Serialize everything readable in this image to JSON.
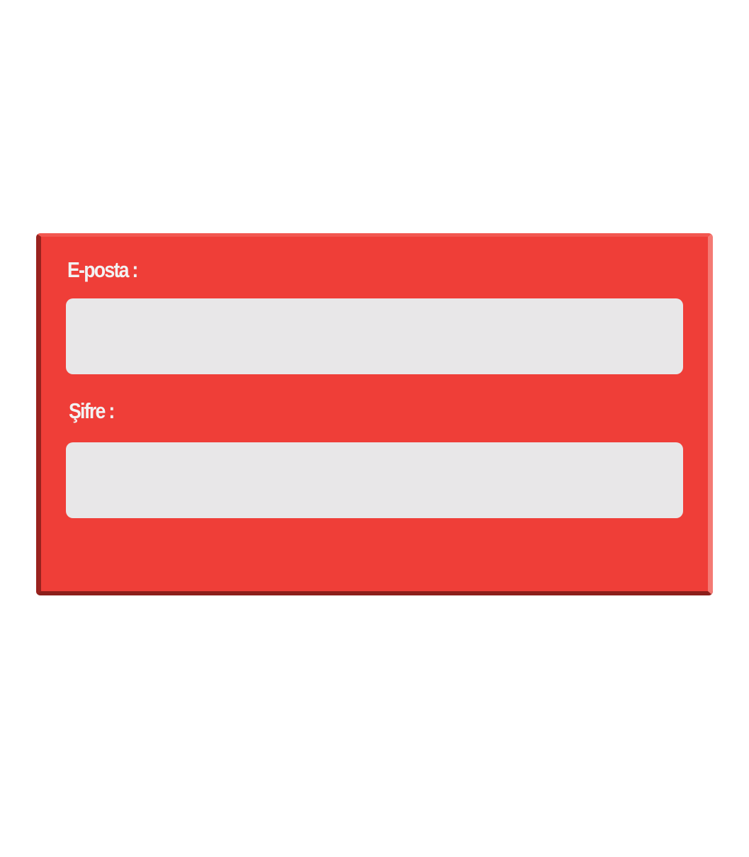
{
  "form": {
    "email": {
      "label": "E-posta :",
      "value": "",
      "placeholder": ""
    },
    "password": {
      "label": "Şifre :",
      "value": "",
      "placeholder": ""
    }
  },
  "colors": {
    "panel": "#ef3e38",
    "input_background": "#e8e7e8",
    "label_text": "#f2f2f2",
    "page_background": "#ffffff"
  }
}
